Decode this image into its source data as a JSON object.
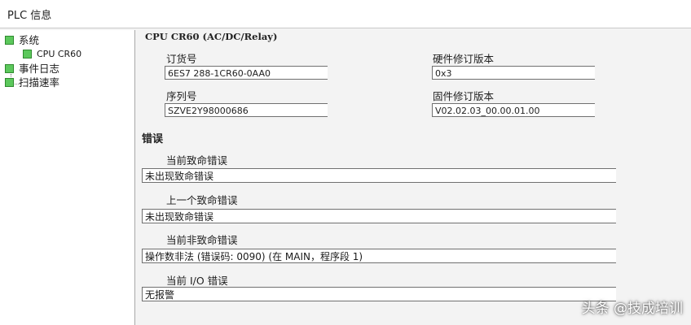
{
  "window": {
    "title": "PLC 信息"
  },
  "sidebar": {
    "items": [
      {
        "label": "系统"
      },
      {
        "label": "CPU CR60"
      },
      {
        "label": "事件日志"
      },
      {
        "label": "扫描速率"
      }
    ]
  },
  "main": {
    "cpu_title": "CPU CR60 (AC/DC/Relay)",
    "order_number": {
      "label": "订货号",
      "value": "6ES7 288-1CR60-0AA0"
    },
    "hardware_revision": {
      "label": "硬件修订版本",
      "value": "0x3"
    },
    "serial_number": {
      "label": "序列号",
      "value": "SZVE2Y98000686"
    },
    "firmware_revision": {
      "label": "固件修订版本",
      "value": "V02.02.03_00.00.01.00"
    },
    "errors": {
      "title": "错误",
      "current_fatal": {
        "label": "当前致命错误",
        "value": "未出现致命错误"
      },
      "last_fatal": {
        "label": "上一个致命错误",
        "value": "未出现致命错误"
      },
      "current_nonfatal": {
        "label": "当前非致命错误",
        "value": "操作数非法 (错误码: 0090) (在 MAIN，程序段 1)"
      },
      "current_io": {
        "label": "当前 I/O 错误",
        "value": "无报警"
      }
    }
  },
  "watermark": "头条 @技成培训",
  "colors": {
    "tree_icon": "#5cc85c",
    "window_bg": "#f4f4f4"
  }
}
